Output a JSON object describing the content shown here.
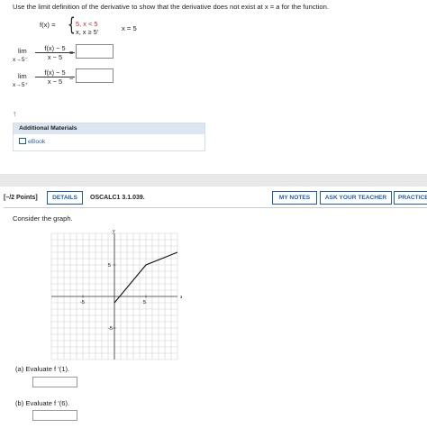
{
  "question1": {
    "prompt": "Use the limit definition of the derivative to show that the derivative does not exist at x = a for the function.",
    "f_label": "f(x) =",
    "piece1": "5,  x < 5",
    "piece2": "x,  x ≥ 5'",
    "x_equals": "x = 5",
    "limits": [
      {
        "lim": "lim",
        "sub": "x→5⁻",
        "numerator": "f(x) − 5",
        "denominator": "x − 5",
        "equals": "="
      },
      {
        "lim": "lim",
        "sub": "x→5⁺",
        "numerator": "f(x) − 5",
        "denominator": "x − 5",
        "equals": "="
      }
    ],
    "arrow": "↑",
    "additional_materials": "Additional Materials",
    "ebook": "eBook"
  },
  "question2": {
    "points": "[–/2 Points]",
    "details_button": "DETAILS",
    "code": "OSCALC1 3.1.039.",
    "my_notes_button": "MY NOTES",
    "ask_teacher_button": "ASK YOUR TEACHER",
    "practice_button": "PRACTICE",
    "consider": "Consider the graph.",
    "part_a": "(a)   Evaluate f ′(1).",
    "part_b": "(b)   Evaluate f ′(6)."
  },
  "chart_data": {
    "type": "line",
    "xlabel": "x",
    "ylabel": "y",
    "xlim": [
      -10,
      10
    ],
    "ylim": [
      -10,
      10
    ],
    "grid": true,
    "tick_labels": {
      "x": [
        "-5",
        "5"
      ],
      "y": [
        "5",
        "-5"
      ]
    },
    "series": [
      {
        "x": [
          0,
          5,
          10
        ],
        "y": [
          -1,
          5,
          7
        ]
      }
    ]
  }
}
